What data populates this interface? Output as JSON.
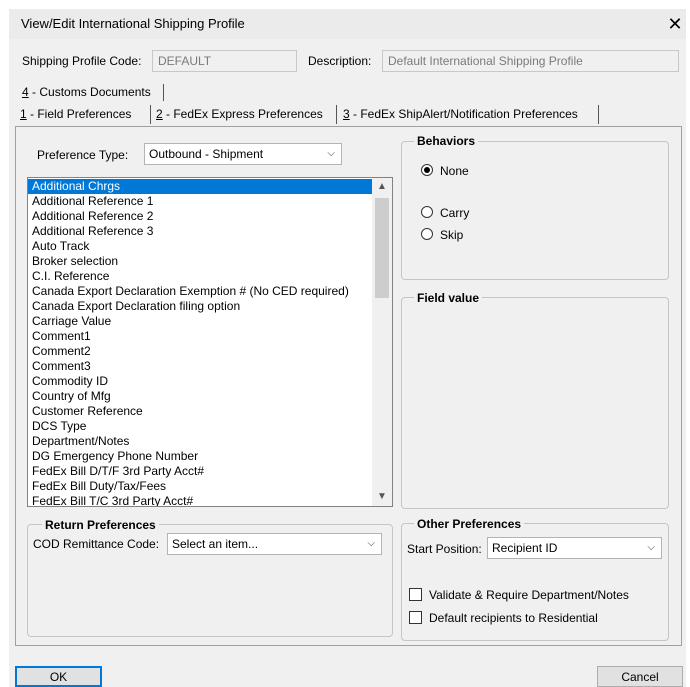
{
  "window": {
    "title": "View/Edit International Shipping Profile",
    "close": "✕"
  },
  "profile": {
    "code_label": "Shipping Profile Code:",
    "code_value": "DEFAULT",
    "desc_label": "Description:",
    "desc_value": "Default International Shipping Profile"
  },
  "tabs": {
    "customs": {
      "key": "4",
      "text": " - Customs Documents"
    },
    "field": {
      "key": "1",
      "text": " - Field Preferences"
    },
    "express": {
      "key": "2",
      "text": " - FedEx Express Preferences"
    },
    "shipalert": {
      "key": "3",
      "text": " - FedEx ShipAlert/Notification Preferences"
    }
  },
  "preference": {
    "label": "Preference Type:",
    "value": "Outbound - Shipment",
    "list": [
      "Additional Chrgs",
      "Additional Reference 1",
      "Additional Reference 2",
      "Additional Reference 3",
      "Auto Track",
      "Broker selection",
      "C.I. Reference",
      "Canada Export Declaration Exemption # (No CED required)",
      "Canada Export Declaration filing option",
      "Carriage Value",
      "Comment1",
      "Comment2",
      "Comment3",
      "Commodity ID",
      "Country of Mfg",
      "Customer Reference",
      "DCS Type",
      "Department/Notes",
      "DG Emergency Phone Number",
      "FedEx Bill D/T/F 3rd Party Acct#",
      "FedEx Bill Duty/Tax/Fees",
      "FedEx Bill T/C 3rd Party Acct#"
    ]
  },
  "behaviors": {
    "title": "Behaviors",
    "none": "None",
    "carry": "Carry",
    "skip": "Skip",
    "selected": "None"
  },
  "field_value": {
    "title": "Field value"
  },
  "return_prefs": {
    "title": "Return Preferences",
    "cod_label": "COD Remittance Code:",
    "cod_value": "Select an item..."
  },
  "other_prefs": {
    "title": "Other Preferences",
    "start_label": "Start Position:",
    "start_value": "Recipient ID",
    "validate_label": "Validate & Require Department/Notes",
    "residential_label": "Default recipients to Residential"
  },
  "buttons": {
    "ok": "OK",
    "cancel": "Cancel"
  }
}
